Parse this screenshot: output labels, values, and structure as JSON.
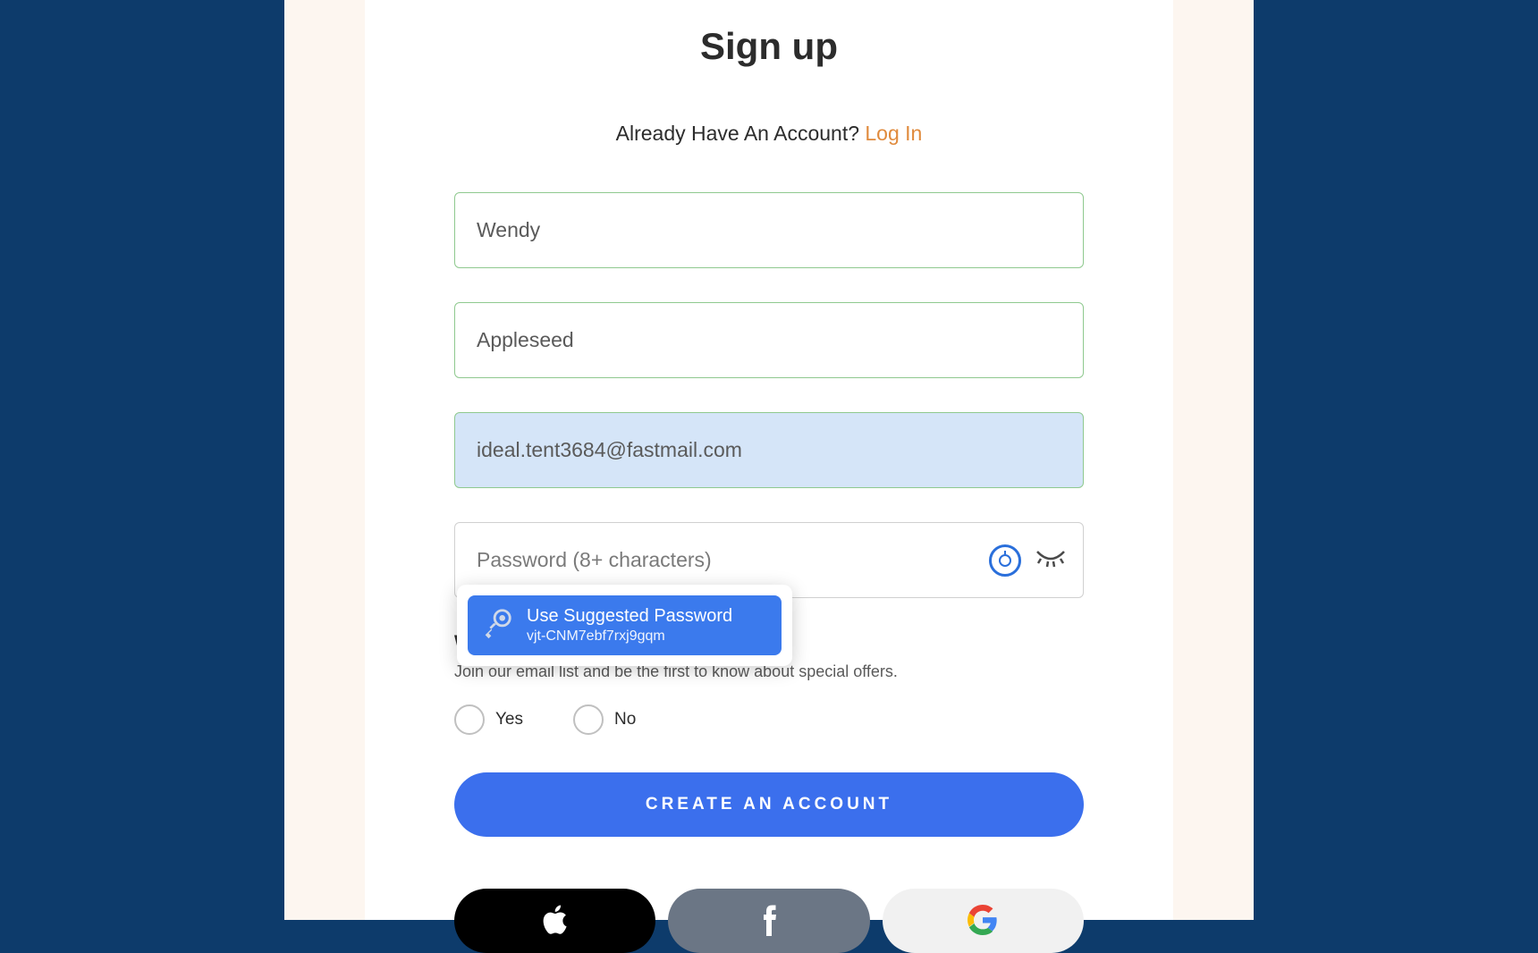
{
  "title": "Sign up",
  "login_prompt": {
    "text": "Already Have An Account? ",
    "link": "Log In"
  },
  "form": {
    "first_name": "Wendy",
    "last_name": "Appleseed",
    "email": "ideal.tent3684@fastmail.com",
    "password_placeholder": "Password (8+ characters)"
  },
  "password_suggestion": {
    "title": "Use Suggested Password",
    "value": "vjt-CNM7ebf7rxj9gqm"
  },
  "mailing": {
    "question": "Want To Join Our Mailing List?",
    "description": "Join our email list and be the first to know about special offers.",
    "yes": "Yes",
    "no": "No"
  },
  "submit_button": "CREATE AN ACCOUNT"
}
